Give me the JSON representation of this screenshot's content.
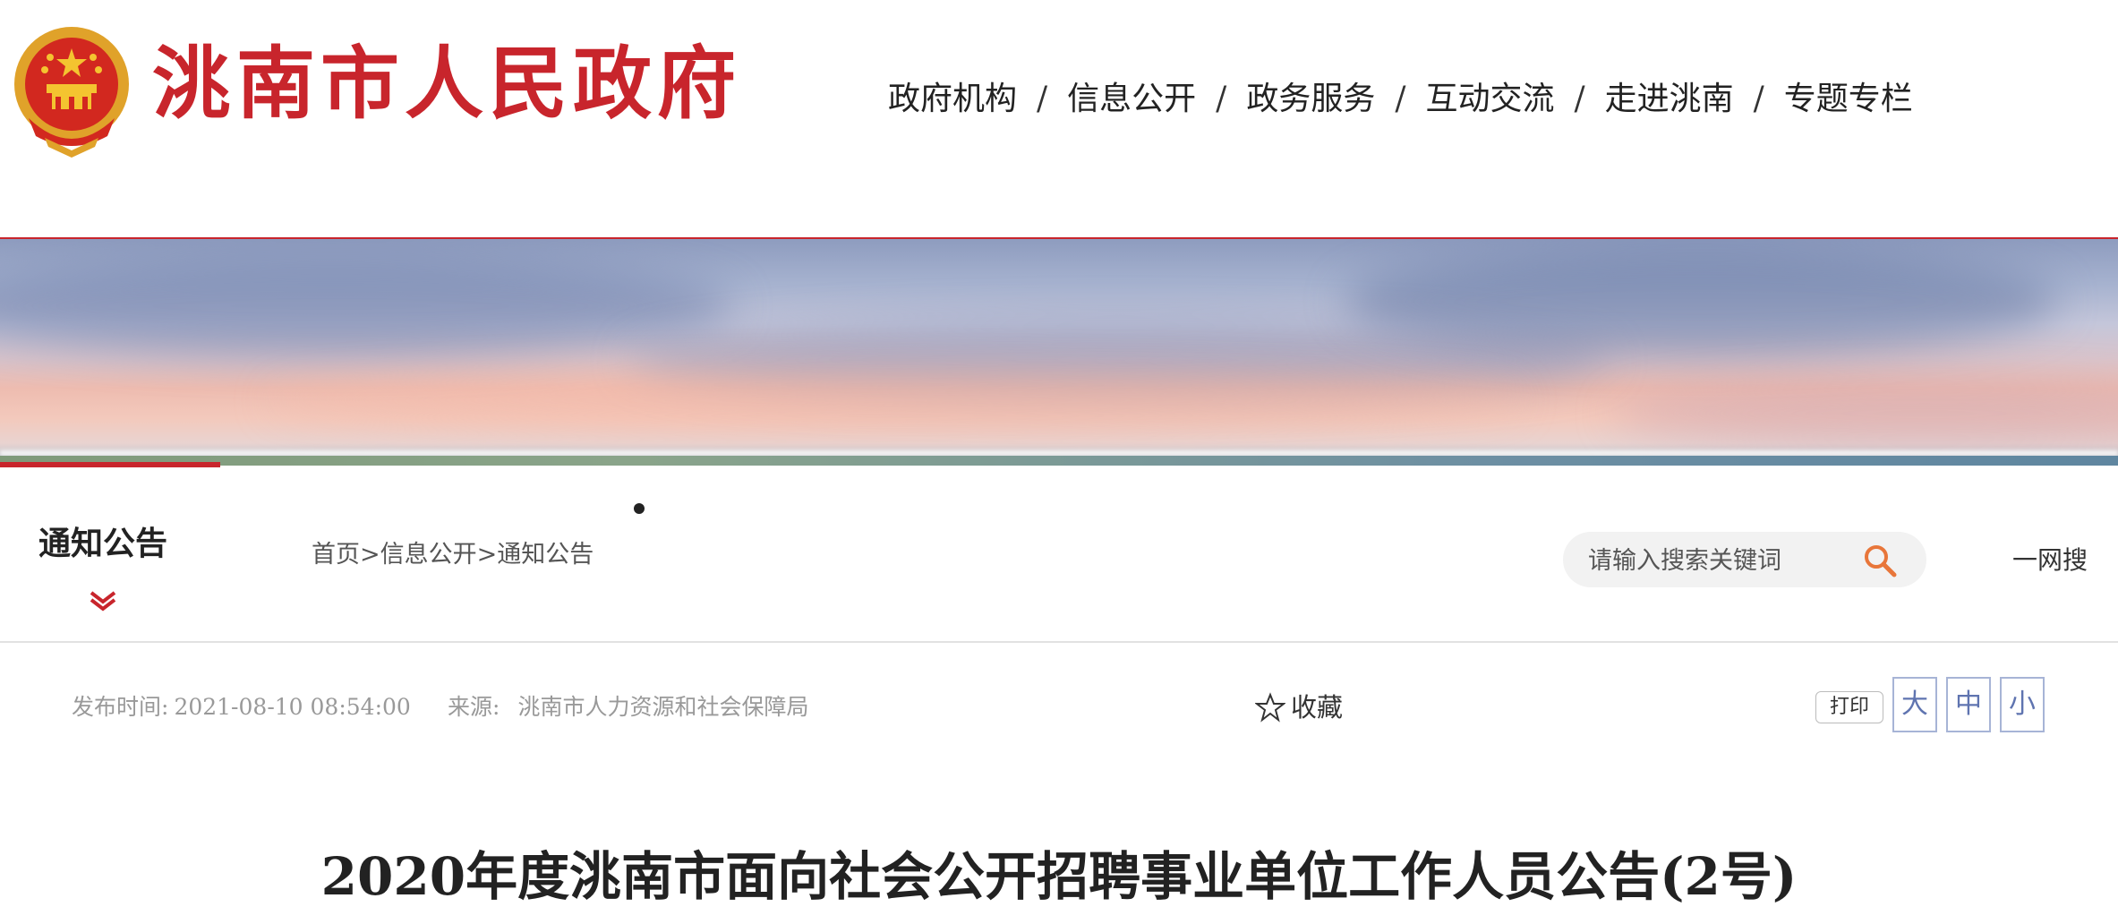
{
  "header": {
    "site_title": "洮南市人民政府",
    "nav": [
      {
        "label": "政府机构"
      },
      {
        "label": "信息公开"
      },
      {
        "label": "政务服务"
      },
      {
        "label": "互动交流"
      },
      {
        "label": "走进洮南"
      },
      {
        "label": "专题专栏"
      }
    ],
    "nav_separator": "/"
  },
  "section": {
    "label": "通知公告"
  },
  "breadcrumb": {
    "home": "首页",
    "sep1": ">",
    "level1": "信息公开",
    "sep2": ">",
    "current": "通知公告"
  },
  "search": {
    "placeholder": "请输入搜索关键词",
    "one_search": "一网搜"
  },
  "article_meta": {
    "publish_label": "发布时间:",
    "publish_time": "2021-08-10 08:54:00",
    "source_label": "来源:",
    "source": "洮南市人力资源和社会保障局",
    "favorite_label": "收藏",
    "print_label": "打印",
    "font_large": "大",
    "font_medium": "中",
    "font_small": "小"
  },
  "article": {
    "title": "2020年度洮南市面向社会公开招聘事业单位工作人员公告(2号)"
  },
  "colors": {
    "brand_red": "#c8252c",
    "font_button": "#5f74b0",
    "meta_gray": "#999999"
  },
  "icons": [
    "national-emblem-icon",
    "chevron-down-icon",
    "search-icon",
    "star-icon"
  ]
}
